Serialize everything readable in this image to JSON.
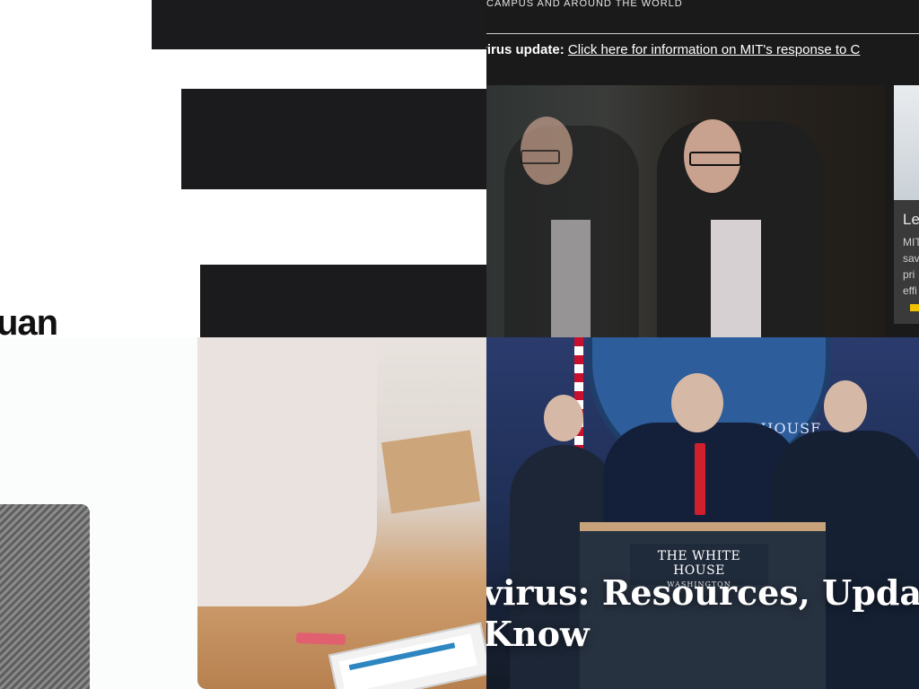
{
  "top_right": {
    "tagline": "CAMPUS AND AROUND THE WORLD",
    "alert_label": "ronavirus update:",
    "alert_link": "Click here for information on MIT's response to C",
    "side_card_title": "Le",
    "side_card_snippet": "MIT\nsav\npri\neffi"
  },
  "bottom_right": {
    "seal_text": "THE WHITE HOUSE",
    "podium_line1": "THE WHITE HOUSE",
    "podium_line2": "WASHINGTON",
    "headline": "virus: Resources, Updates,\nKnow"
  },
  "top_left": {
    "partial_heading": "uan"
  },
  "colors": {
    "dark_bar": "#1b1a1c",
    "press_blue": "#2b3b6d",
    "accent_red": "#d01f2d",
    "accent_yellow": "#f2c100"
  }
}
